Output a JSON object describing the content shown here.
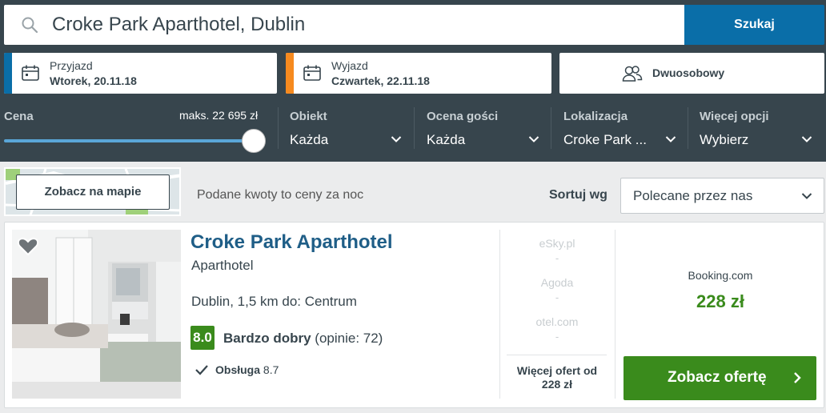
{
  "search": {
    "query": "Croke Park Aparthotel, Dublin",
    "button": "Szukaj"
  },
  "checkin": {
    "label": "Przyjazd",
    "value": "Wtorek, 20.11.18",
    "accent": "#0a6ea8"
  },
  "checkout": {
    "label": "Wyjazd",
    "value": "Czwartek, 22.11.18",
    "accent": "#f68a1f"
  },
  "room": {
    "value": "Dwuosobowy"
  },
  "filters": {
    "price": {
      "label": "Cena",
      "max": "maks. 22 695 zł",
      "slider_fraction": 1.0
    },
    "type": {
      "label": "Obiekt",
      "value": "Każda"
    },
    "rating": {
      "label": "Ocena gości",
      "value": "Każda"
    },
    "location": {
      "label": "Lokalizacja",
      "value": "Croke Park ..."
    },
    "more": {
      "label": "Więcej opcji",
      "value": "Wybierz"
    }
  },
  "toolbar": {
    "map_button": "Zobacz na mapie",
    "price_note": "Podane kwoty to ceny za noc",
    "sort_label": "Sortuj wg",
    "sort_value": "Polecane przez nas"
  },
  "hotel": {
    "name": "Croke Park Aparthotel",
    "type": "Aparthotel",
    "location": "Dublin, 1,5 km do: Centrum",
    "rating_score": "8.0",
    "rating_label": "Bardzo dobry",
    "rating_reviews": "(opinie: 72)",
    "service_label": "Obsługa",
    "service_score": "8.7",
    "providers": [
      {
        "name": "eSky.pl",
        "price": "-"
      },
      {
        "name": "Agoda",
        "price": "-"
      },
      {
        "name": "otel.com",
        "price": "-"
      }
    ],
    "more_offers_line1": "Więcej ofert od",
    "more_offers_line2": "228 zł",
    "best_provider": "Booking.com",
    "best_price": "228 zł",
    "offer_button": "Zobacz ofertę"
  },
  "colors": {
    "header_bg": "#37454d",
    "primary_blue": "#0a6ea8",
    "green": "#3a8b1c",
    "hotel_name": "#1f5e87"
  }
}
